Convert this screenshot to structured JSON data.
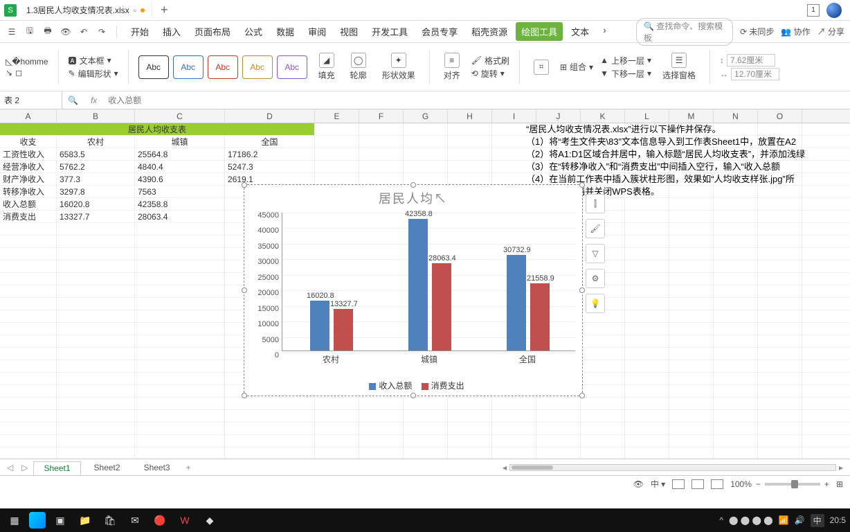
{
  "title_tab": "1.3居民人均收支情况表.xlsx",
  "menus": [
    "开始",
    "插入",
    "页面布局",
    "公式",
    "数据",
    "审阅",
    "视图",
    "开发工具",
    "会员专享",
    "稻壳资源",
    "绘图工具",
    "文本"
  ],
  "active_menu_index": 10,
  "qat_search_placeholder": "查找命令、搜索模板",
  "right_tools": {
    "unsync": "未同步",
    "collab": "协作",
    "share": "分享"
  },
  "ribbon": {
    "textbox": "文本框",
    "editshape": "编辑形状",
    "abc": "Abc",
    "fill": "填充",
    "outline": "轮廓",
    "shapefx": "形状效果",
    "align": "对齐",
    "rotate": "旋转",
    "fmtpaint": "格式刷",
    "group": "组合",
    "combine": "组合",
    "fwd": "上移一层",
    "bwd": "下移一层",
    "selpane": "选择窗格",
    "width": "7.62厘米",
    "height": "12.70厘米"
  },
  "namebox": "表 2",
  "formula": "收入总额",
  "columns": [
    "A",
    "B",
    "C",
    "D",
    "E",
    "F",
    "G",
    "H",
    "I",
    "J",
    "K",
    "L",
    "M",
    "N",
    "O"
  ],
  "table": {
    "merged_title": "居民人均收支表",
    "header": [
      "收支",
      "农村",
      "城镇",
      "全国"
    ],
    "rows": [
      [
        "工资性收入",
        "6583.5",
        "25564.8",
        "17186.2"
      ],
      [
        "经营净收入",
        "5762.2",
        "4840.4",
        "5247.3"
      ],
      [
        "财产净收入",
        "377.3",
        "4390.6",
        "2619.1"
      ],
      [
        "转移净收入",
        "3297.8",
        "7563",
        ""
      ],
      [
        "收入总额",
        "16020.8",
        "42358.8",
        ""
      ],
      [
        "消费支出",
        "13327.7",
        "28063.4",
        ""
      ]
    ]
  },
  "instructions": [
    "“居民人均收支情况表.xlsx”进行以下操作并保存。",
    "（1）将“考生文件夹\\83”文本信息导入到工作表Sheet1中，放置在A2",
    "（2）将A1:D1区域合并居中，输入标题“居民人均收支表”，并添加浅绿",
    "（3）在“转移净收入”和“消费支出”中间插入空行，输入“收入总额",
    "（4）在当前工作表中插入簇状柱形图，效果如“人均收支样张.jpg”所",
    "（5）保存文档并关闭WPS表格。"
  ],
  "chart_data": {
    "type": "bar",
    "title": "居民人均",
    "categories": [
      "农村",
      "城镇",
      "全国"
    ],
    "series": [
      {
        "name": "收入总额",
        "values": [
          16020.8,
          42358.8,
          30732.9
        ],
        "color": "#4f81bd"
      },
      {
        "name": "消费支出",
        "values": [
          13327.7,
          28063.4,
          21558.9
        ],
        "color": "#c0504d"
      }
    ],
    "ylim": [
      0,
      45000
    ],
    "yticks": [
      0,
      5000,
      10000,
      15000,
      20000,
      25000,
      30000,
      35000,
      40000,
      45000
    ]
  },
  "sheets": [
    "Sheet1",
    "Sheet2",
    "Sheet3"
  ],
  "active_sheet": 0,
  "zoom": "100%",
  "clock": "20:5"
}
